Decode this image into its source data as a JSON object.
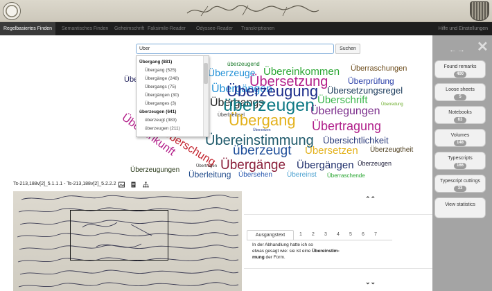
{
  "nav": {
    "items": [
      "Regelbasiertes Finden",
      "Semantisches Finden",
      "Geheimschrift",
      "Faksimile-Reader",
      "Odyssee-Reader",
      "Transkriptionen"
    ],
    "settings": "Hilfe und Einstellungen"
  },
  "search": {
    "value": "Über",
    "button": "Suchen"
  },
  "dropdown": {
    "items": [
      "Übergang (881)",
      "Übergang (525)",
      "Übergänge (248)",
      "Übergangs (75)",
      "Übergängen (30)",
      "Überganges (3)",
      "überzeugen (641)",
      "überzeugt (383)",
      "überzeugen (211)"
    ]
  },
  "cloud": {
    "words": [
      {
        "text": "überzeugend",
        "color": "#1a7a2a"
      },
      {
        "text": "Übereinkommen",
        "color": "#2aa632"
      },
      {
        "text": "Überraschungen",
        "color": "#6b4a1a"
      },
      {
        "text": "Überzeuge",
        "color": "#1f8fd6"
      },
      {
        "text": "Übersetzung",
        "color": "#b31f8a"
      },
      {
        "text": "Überprüfung",
        "color": "#2a3fa8"
      },
      {
        "text": "Übergängen",
        "color": "#1f8fd6"
      },
      {
        "text": "Überzeugung",
        "color": "#1c2c8a"
      },
      {
        "text": "Übersetzungsregel",
        "color": "#1a3a5a"
      },
      {
        "text": "Übe",
        "color": "#1f1f5a"
      },
      {
        "text": "Übergangs",
        "color": "#222222"
      },
      {
        "text": "überzeugen",
        "color": "#0f7a85"
      },
      {
        "text": "Überschrift",
        "color": "#39b54a"
      },
      {
        "text": "Überredung",
        "color": "#66aa22"
      },
      {
        "text": "Überlegungen",
        "color": "#7b2d8b"
      },
      {
        "text": "Überbleibsel",
        "color": "#333333"
      },
      {
        "text": "Übergang",
        "color": "#e3b11b"
      },
      {
        "text": "Übertragung",
        "color": "#b01f8a"
      },
      {
        "text": "Übereinstimmung",
        "color": "#1f5a6b"
      },
      {
        "text": "Übersichtlichkeit",
        "color": "#2a3a7a"
      },
      {
        "text": "überzeugt",
        "color": "#1f4f9a"
      },
      {
        "text": "Übersetzen",
        "color": "#e3b11b"
      },
      {
        "text": "Überzeugtheit",
        "color": "#4a3a1a"
      },
      {
        "text": "Überschung",
        "color": "#c21f2a"
      },
      {
        "text": "Übereinkunft",
        "color": "#b31f8a"
      },
      {
        "text": "Übergänge",
        "color": "#8a1f3a"
      },
      {
        "text": "Übergängen",
        "color": "#1f2f6b"
      },
      {
        "text": "Überzeugen",
        "color": "#1f1f3a"
      },
      {
        "text": "Überzeugungen",
        "color": "#2a3a1a"
      },
      {
        "text": "Überleitung",
        "color": "#1f4a8a"
      },
      {
        "text": "Übersehen",
        "color": "#2a5ab0"
      },
      {
        "text": "Übereinst",
        "color": "#4aa0d0"
      },
      {
        "text": "Überraschende",
        "color": "#2aa632"
      },
      {
        "text": "Übertragen",
        "color": "#333333"
      },
      {
        "text": "Übersetzen",
        "color": "#1f3a8a"
      }
    ]
  },
  "siglum": "Ts-213,188v[2]_5.1.1.1 - Ts-213,188v[2]_5.2.2.2",
  "tabs": [
    "Ausgangstext",
    "1",
    "2",
    "3",
    "4",
    "5",
    "6",
    "7"
  ],
  "excerpt": {
    "line1": "In der Abhandlung hatte ich so",
    "line2": "etwas gesagt wie: sie ist eine",
    "highlight": "Übereinstim-",
    "highlight2": "mung",
    "tail": "der Form."
  },
  "rpanel": {
    "buttons": [
      {
        "label": "Found remarks",
        "count": "400"
      },
      {
        "label": "Loose sheets",
        "count": "5"
      },
      {
        "label": "Notebooks",
        "count": "63"
      },
      {
        "label": "Volumes",
        "count": "148"
      },
      {
        "label": "Typescripts",
        "count": "166"
      },
      {
        "label": "Typescript cuttings",
        "count": "33"
      },
      {
        "label": "View statistics",
        "count": ""
      }
    ]
  },
  "colors": {
    "nav_bg": "#1e1e1e",
    "panel_bg": "#a4a4a4",
    "accent_blue": "#7aa9d8"
  }
}
